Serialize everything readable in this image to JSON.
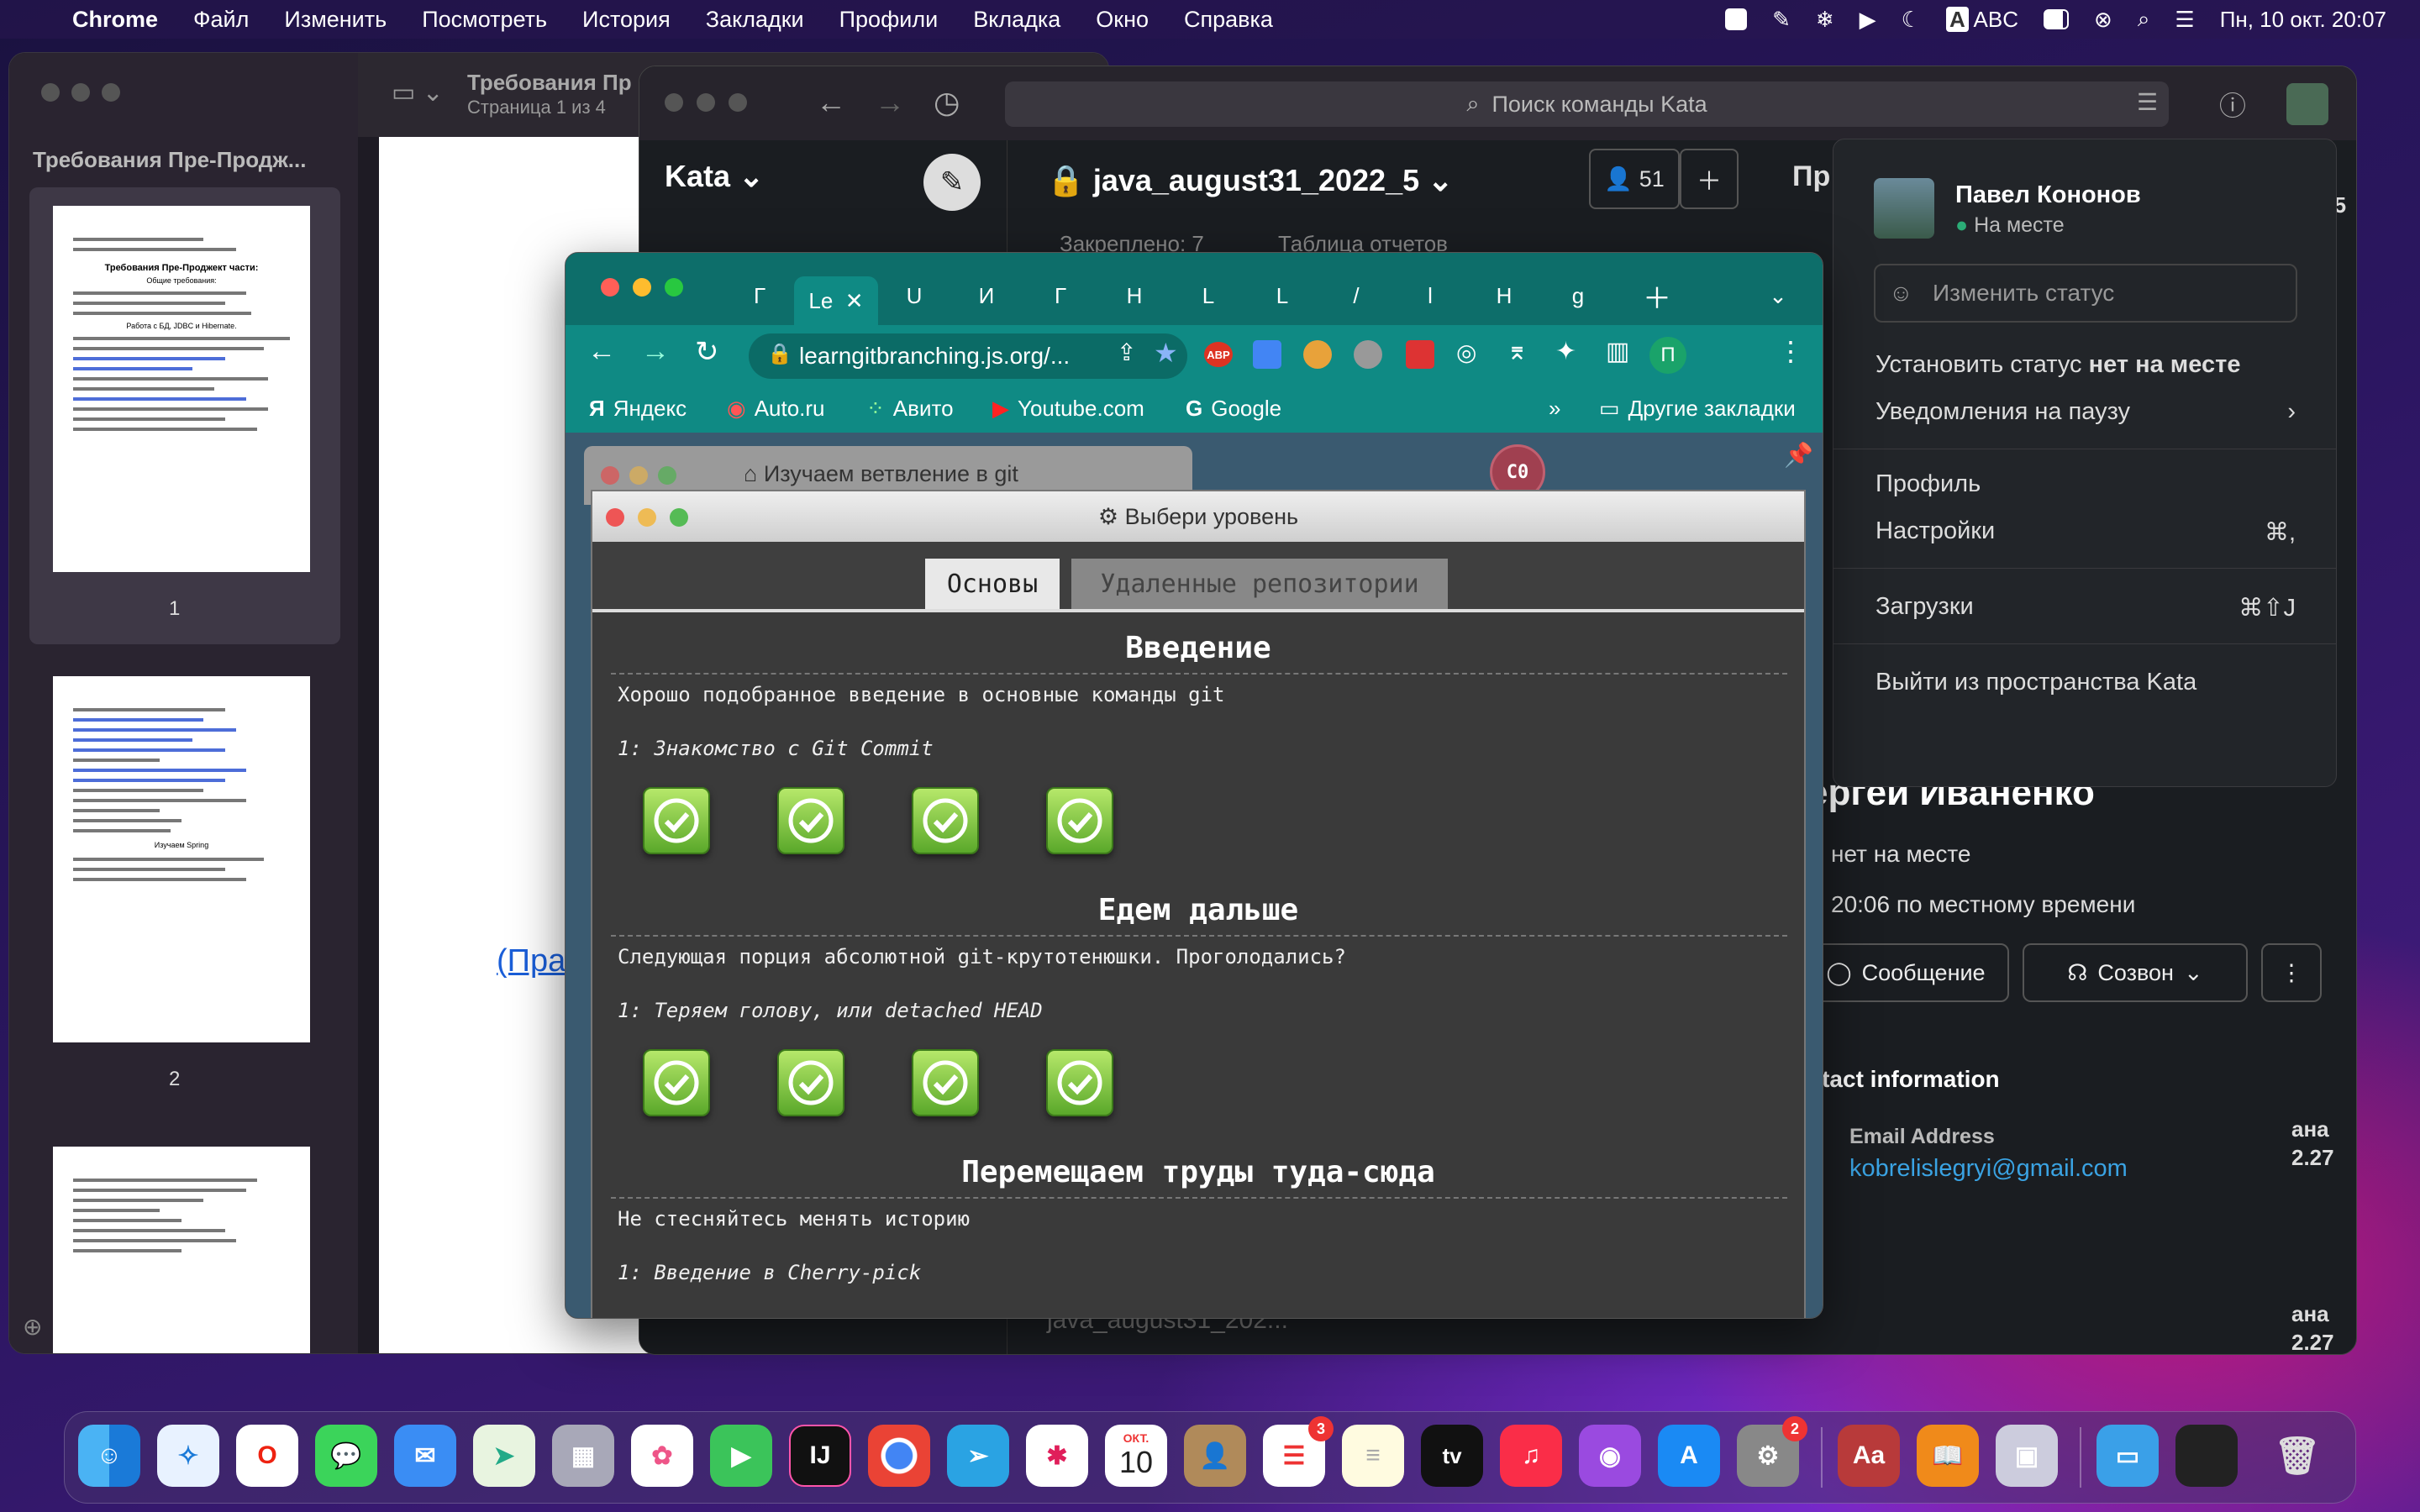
{
  "menubar": {
    "app": "Chrome",
    "items": [
      "Файл",
      "Изменить",
      "Посмотреть",
      "История",
      "Закладки",
      "Профили",
      "Вкладка",
      "Окно",
      "Справка"
    ],
    "input_source": "ABC",
    "clock": "Пн, 10 окт.  20:07"
  },
  "preview": {
    "title": "Требования Пр",
    "subtitle": "Страница 1 из 4",
    "sidebar_title": "Требования Пре-Продж...",
    "thumb1_title": "Требования Пре-Проджект части:",
    "thumb1_sub": "Общие требования:",
    "thumb1_sec": "Работа с БД, JDBC и Hibernate.",
    "thumb2_sec": "Изучаем Spring",
    "pages": [
      "1",
      "2"
    ],
    "link_fragment": "(Прав"
  },
  "slack": {
    "search_placeholder": "Поиск команды Kata",
    "workspace": "Kata",
    "channel": "java_august31_2022_5",
    "member_count": "51",
    "pinned": "Закреплено: 7",
    "table_bookmark": "Таблица отчетов",
    "side_label": "Пр",
    "right_num1": "01.35",
    "right_lbl2": "ана",
    "right_num2": "2.27",
    "right_lbl3": "ана",
    "right_num3": "2.27",
    "footer_channel": "java_august31_202...",
    "menu": {
      "name": "Павел Кононов",
      "presence": "На месте",
      "status_placeholder": "Изменить статус",
      "away_prefix": "Установить статус ",
      "away_bold": "нет на месте",
      "pause": "Уведомления на паузу",
      "profile": "Профиль",
      "settings": "Настройки",
      "settings_shortcut": "⌘,",
      "downloads": "Загрузки",
      "downloads_shortcut": "⌘⇧J",
      "signout": "Выйти из пространства Kata"
    },
    "profile": {
      "name": "ергеи Иваненко",
      "status": "нет на месте",
      "local_time": "20:06 по местному времени",
      "message_btn": "Сообщение",
      "call_btn": "Созвон",
      "contact_header": "ntact information",
      "email_label": "Email Address",
      "email": "kobrelislegryi@gmail.com"
    }
  },
  "chrome": {
    "active_tab": "Le",
    "tabs": [
      "Г",
      "U",
      "И",
      "Г",
      "Н",
      "L",
      "L",
      "/",
      "l",
      "Н",
      "g"
    ],
    "url": "learngitbranching.js.org/...",
    "bookmarks": [
      "Яндекс",
      "Auto.ru",
      "Авито",
      "Youtube.com",
      "Google"
    ],
    "more_bookmarks": "Другие закладки",
    "profile_initial": "П",
    "abp": "ABP"
  },
  "git": {
    "window_title": "Изучаем ветвление в git",
    "avatar": "C0",
    "modal_title": "Выбери уровень",
    "tab_basics": "Основы",
    "tab_remote": "Удаленные репозитории",
    "sections": [
      {
        "title": "Введение",
        "desc": "Хорошо подобранное введение в основные команды git",
        "level": "1: Знакомство с Git Commit"
      },
      {
        "title": "Едем дальше",
        "desc": "Следующая порция абсолютной git-крутотенюшки. Проголодались?",
        "level": "1: Теряем голову, или detached HEAD"
      },
      {
        "title": "Перемещаем труды туда-сюда",
        "desc": "Не стесняйтесь менять историю",
        "level": "1: Введение в Cherry-pick"
      }
    ]
  },
  "dock": {
    "calendar_month": "ОКТ.",
    "calendar_day": "10",
    "reminders_badge": "3",
    "settings_badge": "2",
    "tv": "tv",
    "dict": "Aa",
    "intellij": "IJ"
  }
}
